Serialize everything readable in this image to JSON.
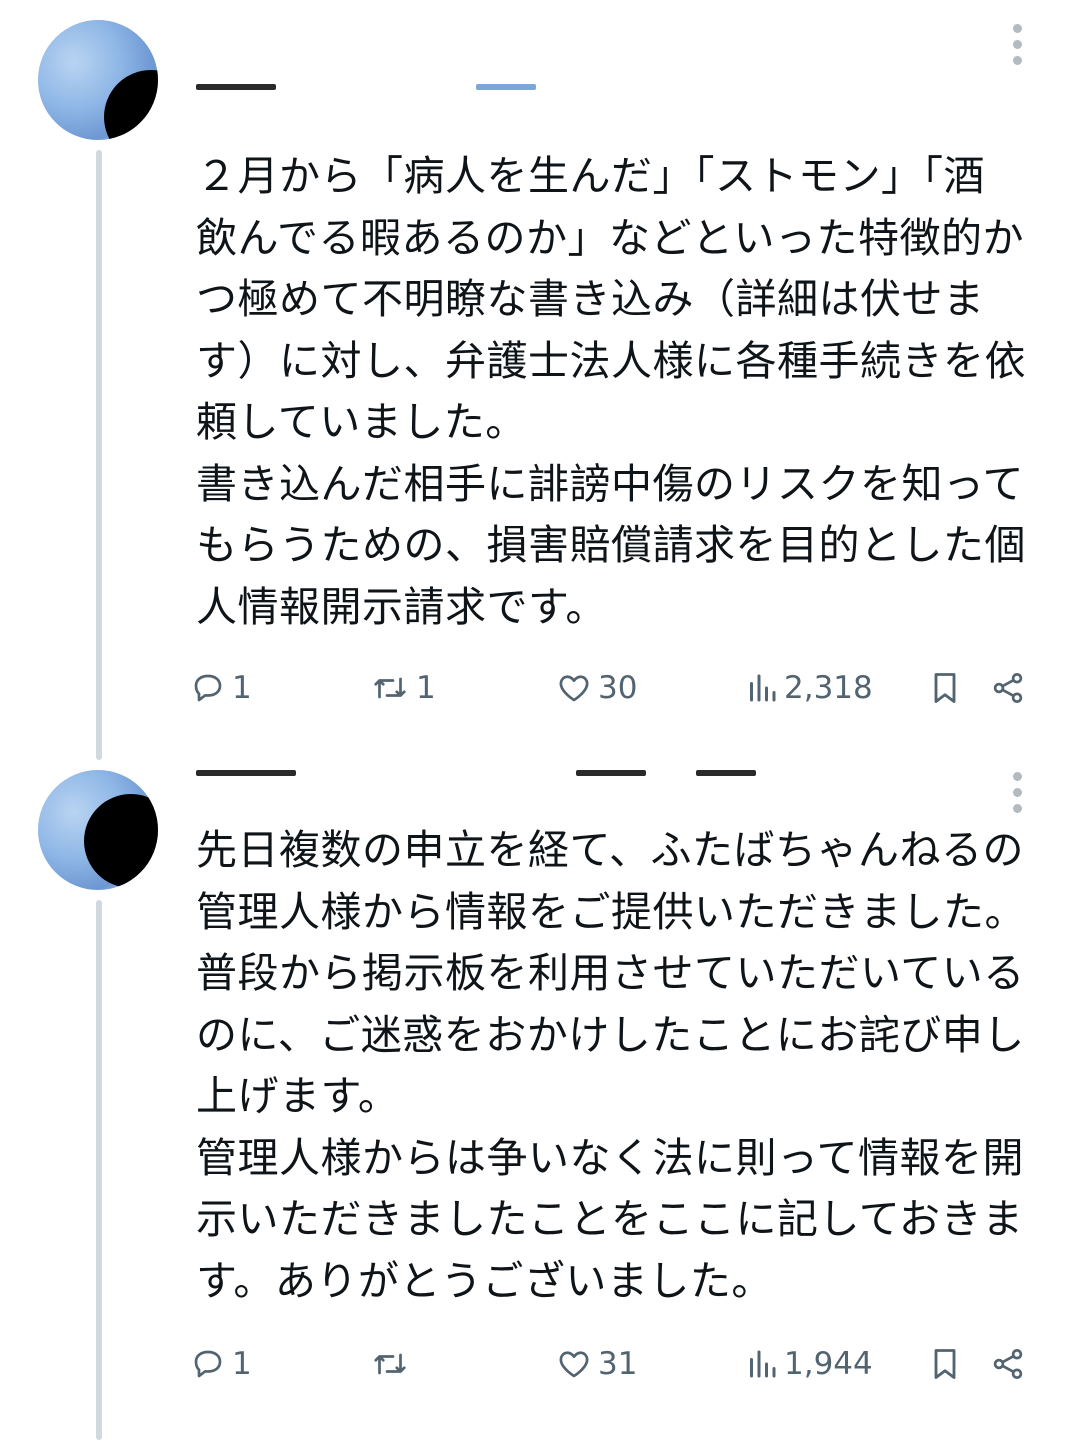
{
  "tweets": [
    {
      "text": "２月から「病人を生んだ」「ストモン」「酒飲んでる暇あるのか」などといった特徴的かつ極めて不明瞭な書き込み（詳細は伏せます）に対し、弁護士法人様に各種手続きを依頼していました。\n書き込んだ相手に誹謗中傷のリスクを知ってもらうための、損害賠償請求を目的とした個人情報開示請求です。",
      "reply_count": "1",
      "retweet_count": "1",
      "like_count": "30",
      "view_count": "2,318"
    },
    {
      "text": "先日複数の申立を経て、ふたばちゃんねるの管理人様から情報をご提供いただきました。普段から掲示板を利用させていただいているのに、ご迷惑をおかけしたことにお詫び申し上げます。\n管理人様からは争いなく法に則って情報を開示いただきましたことをここに記しておきます。ありがとうございました。",
      "reply_count": "1",
      "retweet_count": "",
      "like_count": "31",
      "view_count": "1,944"
    }
  ],
  "colors": {
    "text": "#0f1419",
    "icon_gray": "#536471",
    "thread_line": "#cfd9de"
  },
  "icons": [
    "reply-icon",
    "retweet-icon",
    "like-icon",
    "views-icon",
    "bookmark-icon",
    "share-icon",
    "more-icon"
  ]
}
